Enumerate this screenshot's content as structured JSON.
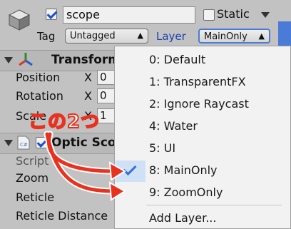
{
  "header": {
    "object_name": "scope",
    "active_checked": true,
    "static_label": "Static",
    "static_checked": false,
    "tag_label": "Tag",
    "tag_value": "Untagged",
    "layer_label": "Layer",
    "layer_value": "MainOnly"
  },
  "transform": {
    "title": "Transform",
    "rows": [
      {
        "label": "Position",
        "axis": "X",
        "value": "0"
      },
      {
        "label": "Rotation",
        "axis": "X",
        "value": "0"
      },
      {
        "label": "Scale",
        "axis": "X",
        "value": "1"
      }
    ]
  },
  "script_component": {
    "title": "Optic Sco",
    "enabled": true,
    "props": [
      "Script",
      "Zoom",
      "Reticle",
      "Reticle Distance"
    ]
  },
  "layer_menu": {
    "items": [
      {
        "label": "0: Default"
      },
      {
        "label": "1: TransparentFX"
      },
      {
        "label": "2: Ignore Raycast"
      },
      {
        "label": "4: Water"
      },
      {
        "label": "5: UI"
      },
      {
        "label": "8: MainOnly",
        "selected": true
      },
      {
        "label": "9: ZoomOnly"
      }
    ],
    "add_label": "Add Layer..."
  },
  "annotation": {
    "text": "この2つ",
    "color": "#e8321f"
  }
}
